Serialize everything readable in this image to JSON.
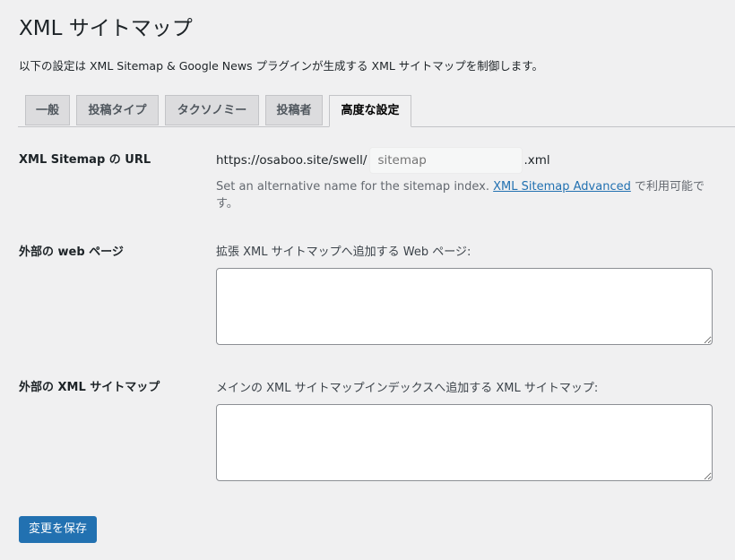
{
  "page": {
    "title": "XML サイトマップ",
    "description": "以下の設定は XML Sitemap & Google News プラグインが生成する XML サイトマップを制御します。"
  },
  "tabs": [
    {
      "label": "一般",
      "active": false
    },
    {
      "label": "投稿タイプ",
      "active": false
    },
    {
      "label": "タクソノミー",
      "active": false
    },
    {
      "label": "投稿者",
      "active": false
    },
    {
      "label": "高度な設定",
      "active": true
    }
  ],
  "sitemap_url": {
    "label": "XML Sitemap の URL",
    "prefix": "https://osaboo.site/swell/",
    "value": "",
    "placeholder": "sitemap",
    "suffix": ".xml",
    "help_before": "Set an alternative name for the sitemap index. ",
    "help_link": "XML Sitemap Advanced",
    "help_after": " で利用可能です。"
  },
  "external_pages": {
    "label": "外部の web ページ",
    "description": "拡張 XML サイトマップへ追加する Web ページ:",
    "value": ""
  },
  "external_sitemaps": {
    "label": "外部の XML サイトマップ",
    "description": "メインの XML サイトマップインデックスへ追加する XML サイトマップ:",
    "value": ""
  },
  "save_button": {
    "label": "変更を保存"
  },
  "colors": {
    "background": "#f0f0f1",
    "accent": "#2271b1",
    "text": "#1d2327"
  }
}
